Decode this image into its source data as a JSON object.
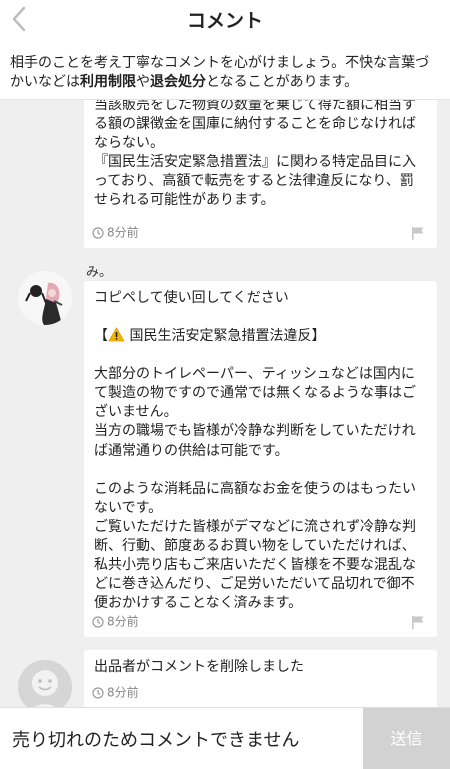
{
  "header": {
    "title": "コメント"
  },
  "notice": {
    "text_1": "相手のことを考え丁寧なコメントを心がけましょう。不快な言葉づかいなどは",
    "link_1": "利用制限",
    "text_2": "や",
    "link_2": "退会処分",
    "text_3": "となることがあります。"
  },
  "comments": [
    {
      "body": "当該販売をした物資の数量を乗じて得た額に相当する額の課徴金を国庫に納付することを命じなければならない。\n『国民生活安定緊急措置法』に関わる特定品目に入っており、高額で転売をすると法律違反になり、罰せられる可能性があります。",
      "time": "8分前"
    },
    {
      "user": "み。",
      "line1": "コピペして使い回してください",
      "line2_pre": "【",
      "line2_post": "国民生活安定緊急措置法違反】",
      "body": "大部分のトイレペーパー、ティッシュなどは国内にて製造の物ですので通常では無くなるような事はございません。\n当方の職場でも皆様が冷静な判断をしていただければ通常通りの供給は可能です。\n\nこのような消耗品に高額なお金を使うのはもったいないです。\nご覧いただけた皆様がデマなどに流されず冷静な判断、行動、節度あるお買い物をしていただければ、私共小売り店もご来店いただく皆様を不要な混乱などに巻き込んだり、ご足労いただいて品切れで御不便おかけすることなく済みます。",
      "time": "8分前"
    },
    {
      "body": "出品者がコメントを削除しました",
      "time": "8分前"
    }
  ],
  "footer": {
    "input_text": "売り切れのためコメントできません",
    "send_label": "送信"
  },
  "colors": {
    "accent_warning": "#f5b400",
    "send_disabled": "#d2d2d2",
    "background": "#efefef"
  }
}
